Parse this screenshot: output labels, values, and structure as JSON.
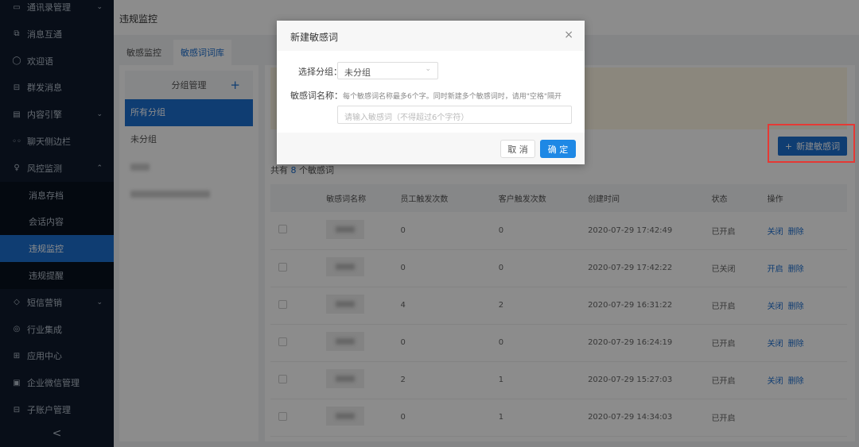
{
  "sidebar": {
    "items": [
      {
        "label": "通讯录管理",
        "icon": "▭",
        "chev": "⌄"
      },
      {
        "label": "消息互通",
        "icon": "⧉",
        "chev": ""
      },
      {
        "label": "欢迎语",
        "icon": "◯",
        "chev": ""
      },
      {
        "label": "群发消息",
        "icon": "⊟",
        "chev": ""
      },
      {
        "label": "内容引擎",
        "icon": "▤",
        "chev": "⌄"
      },
      {
        "label": "聊天侧边栏",
        "icon": "◦◦",
        "chev": ""
      },
      {
        "label": "风控监测",
        "icon": "♀",
        "chev": "⌃"
      }
    ],
    "sub_items": [
      {
        "label": "消息存档"
      },
      {
        "label": "会话内容"
      },
      {
        "label": "违规监控"
      },
      {
        "label": "违规提醒"
      }
    ],
    "items2": [
      {
        "label": "短信营销",
        "icon": "◇",
        "chev": "⌄"
      },
      {
        "label": "行业集成",
        "icon": "◎",
        "chev": ""
      },
      {
        "label": "应用中心",
        "icon": "⊞",
        "chev": ""
      },
      {
        "label": "企业微信管理",
        "icon": "▣",
        "chev": ""
      },
      {
        "label": "子账户管理",
        "icon": "⊟",
        "chev": ""
      }
    ],
    "collapse": "<"
  },
  "header": {
    "title": "违规监控"
  },
  "tabs": [
    {
      "label": "敏感监控"
    },
    {
      "label": "敏感词词库"
    }
  ],
  "groups": {
    "title": "分组管理",
    "add": "+",
    "items": [
      {
        "label": "所有分组"
      },
      {
        "label": "未分组"
      }
    ]
  },
  "main": {
    "new_button": "新建敏感词",
    "new_icon": "+",
    "count_prefix": "共有",
    "count": "8",
    "count_suffix": "个敏感词",
    "columns": [
      "",
      "敏感词名称",
      "员工触发次数",
      "客户触发次数",
      "创建时间",
      "状态",
      "操作"
    ],
    "rows": [
      {
        "staff": "0",
        "customer": "0",
        "time": "2020-07-29 17:42:49",
        "status": "已开启",
        "toggle": "关闭",
        "delete": "删除"
      },
      {
        "staff": "0",
        "customer": "0",
        "time": "2020-07-29 17:42:22",
        "status": "已关闭",
        "toggle": "开启",
        "delete": "删除"
      },
      {
        "staff": "4",
        "customer": "2",
        "time": "2020-07-29 16:31:22",
        "status": "已开启",
        "toggle": "关闭",
        "delete": "删除"
      },
      {
        "staff": "0",
        "customer": "0",
        "time": "2020-07-29 16:24:19",
        "status": "已开启",
        "toggle": "关闭",
        "delete": "删除"
      },
      {
        "staff": "2",
        "customer": "1",
        "time": "2020-07-29 15:27:03",
        "status": "已开启",
        "toggle": "关闭",
        "delete": "删除"
      },
      {
        "staff": "0",
        "customer": "1",
        "time": "2020-07-29 14:34:03",
        "status": "已开启",
        "toggle": "",
        "delete": ""
      }
    ]
  },
  "modal": {
    "title": "新建敏感词",
    "close": "×",
    "group_label": "选择分组：",
    "group_value": "未分组",
    "name_label": "敏感词名称：",
    "hint": "每个敏感词名称最多6个字。同时新建多个敏感词时，请用\"空格\"隔开",
    "placeholder": "请输入敏感词（不得超过6个字符）",
    "cancel": "取 消",
    "ok": "确 定"
  },
  "colors": {
    "primary": "#1d6fd0",
    "sidebar": "#0f1b2d",
    "highlight": "#e53935"
  }
}
